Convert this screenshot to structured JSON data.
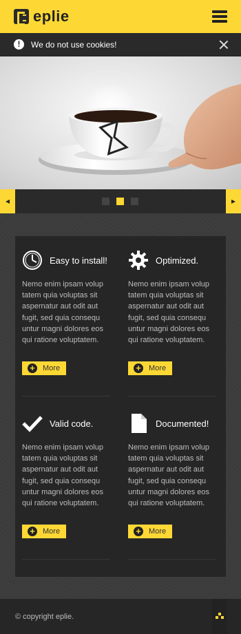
{
  "header": {
    "logo_text": "eplie",
    "menu_icon": "hamburger-icon"
  },
  "cookie_bar": {
    "message": "We do not use cookies!",
    "icon": "info-icon",
    "close_icon": "close-icon"
  },
  "slider": {
    "image": "coffee-cup-with-hourglass-photo",
    "prev_icon": "arrow-left-icon",
    "next_icon": "arrow-right-icon",
    "slides": 3,
    "active_slide": 2
  },
  "features": [
    {
      "title": "Easy to install!",
      "icon": "clock-icon",
      "text": "Nemo enim ipsam volup tatem quia voluptas sit aspernatur aut odit aut fugit, sed quia consequ untur magni dolores eos qui ratione voluptatem.",
      "more_label": "More"
    },
    {
      "title": "Optimized.",
      "icon": "gear-icon",
      "text": "Nemo enim ipsam volup tatem quia voluptas sit aspernatur aut odit aut fugit, sed quia consequ untur magni dolores eos qui ratione voluptatem.",
      "more_label": "More"
    },
    {
      "title": "Valid code.",
      "icon": "checkmark-icon",
      "text": "Nemo enim ipsam volup tatem quia voluptas sit aspernatur aut odit aut fugit, sed quia consequ untur magni dolores eos qui ratione voluptatem.",
      "more_label": "More"
    },
    {
      "title": "Documented!",
      "icon": "document-icon",
      "text": "Nemo enim ipsam volup tatem quia voluptas sit aspernatur aut odit aut fugit, sed quia consequ untur magni dolores eos qui ratione voluptatem.",
      "more_label": "More"
    }
  ],
  "footer": {
    "copyright": "© copyright eplie.",
    "top_icon": "scroll-top-icon"
  },
  "colors": {
    "accent": "#fdd835",
    "dark": "#262626",
    "background": "#3a3a3a"
  }
}
